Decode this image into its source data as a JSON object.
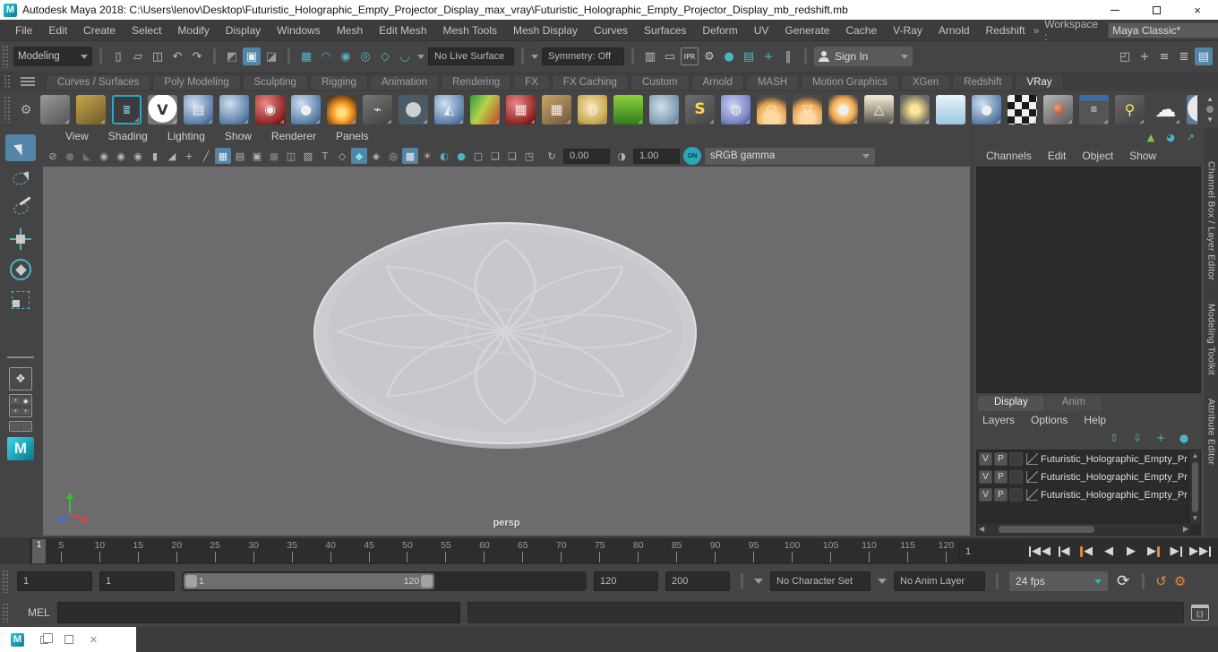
{
  "colors": {
    "accent": "#5285a6",
    "teal": "#4db5c4",
    "orange": "#dd8b3a",
    "maya_teal": "#12a5b5"
  },
  "titlebar": {
    "title": "Autodesk Maya 2018: C:\\Users\\lenov\\Desktop\\Futuristic_Holographic_Empty_Projector_Display_max_vray\\Futuristic_Holographic_Empty_Projector_Display_mb_redshift.mb"
  },
  "menubar": {
    "items": [
      "File",
      "Edit",
      "Create",
      "Select",
      "Modify",
      "Display",
      "Windows",
      "Mesh",
      "Edit Mesh",
      "Mesh Tools",
      "Mesh Display",
      "Curves",
      "Surfaces",
      "Deform",
      "UV",
      "Generate",
      "Cache",
      "V-Ray",
      "Arnold",
      "Redshift"
    ],
    "chevrons": "»",
    "workspace_label": "Workspace :",
    "workspace_value": "Maya Classic*"
  },
  "statusline": {
    "mode_selector": "Modeling",
    "file_icons": [
      {
        "name": "new-scene-icon",
        "label": "▯"
      },
      {
        "name": "open-scene-icon",
        "label": "▱"
      },
      {
        "name": "save-scene-icon",
        "label": "◫"
      },
      {
        "name": "undo-icon",
        "label": "↶"
      },
      {
        "name": "redo-icon",
        "label": "↷"
      }
    ],
    "select_icons": [
      {
        "name": "select-hierarchy-icon",
        "label": "◩",
        "c": "dim2"
      },
      {
        "name": "select-object-icon",
        "label": "▣",
        "active": true
      },
      {
        "name": "select-component-icon",
        "label": "◪",
        "c": "dim2"
      }
    ],
    "snap_icons": [
      {
        "name": "snap-grid-icon",
        "label": "▦",
        "c": "teal"
      },
      {
        "name": "snap-curve-icon",
        "label": "◠",
        "c": "teal"
      },
      {
        "name": "snap-point-icon",
        "label": "◉",
        "c": "teal"
      },
      {
        "name": "snap-projected-center-icon",
        "label": "◎",
        "c": "teal"
      },
      {
        "name": "snap-view-plane-icon",
        "label": "◇",
        "c": "teal"
      },
      {
        "name": "make-live-icon",
        "label": "◡",
        "c": "teal"
      }
    ],
    "live_surface": "No Live Surface",
    "symmetry": "Symmetry: Off",
    "render_icons": [
      {
        "name": "render-view-icon",
        "label": "▥"
      },
      {
        "name": "render-current-frame-icon",
        "label": "▭"
      },
      {
        "name": "ipr-render-icon",
        "label": "IPR",
        "c": "ipr"
      },
      {
        "name": "render-settings-icon",
        "label": "⚙"
      },
      {
        "name": "render-sphere-icon",
        "label": "●",
        "c": "teal"
      },
      {
        "name": "render-layers-icon",
        "label": "▤",
        "c": "teal"
      },
      {
        "name": "hypershade-icon",
        "label": "+",
        "c": "teal"
      },
      {
        "name": "pause-viewport-icon",
        "label": "‖"
      }
    ],
    "sign_in": "Sign In",
    "sidebar_toggles": [
      {
        "name": "show-modeling-toolkit-icon",
        "label": "◰"
      },
      {
        "name": "show-humanik-icon",
        "label": "+"
      },
      {
        "name": "show-channel-box-icon",
        "label": "≡"
      },
      {
        "name": "show-attribute-editor-icon",
        "label": "≣"
      },
      {
        "name": "show-tool-settings-icon",
        "label": "▤",
        "active": true
      }
    ]
  },
  "shelf": {
    "tabs": [
      {
        "label": "Curves / Surfaces"
      },
      {
        "label": "Poly Modeling"
      },
      {
        "label": "Sculpting"
      },
      {
        "label": "Rigging"
      },
      {
        "label": "Animation"
      },
      {
        "label": "Rendering"
      },
      {
        "label": "FX"
      },
      {
        "label": "FX Caching"
      },
      {
        "label": "Custom"
      },
      {
        "label": "Arnold"
      },
      {
        "label": "MASH"
      },
      {
        "label": "Motion Graphics"
      },
      {
        "label": "XGen"
      },
      {
        "label": "Redshift"
      },
      {
        "label": "VRay",
        "active": true
      }
    ],
    "icons": [
      {
        "name": "vray-mesh-export-icon",
        "c": "s-gray"
      },
      {
        "name": "vray-mesh-import-icon",
        "c": "s-folder"
      },
      {
        "name": "vray-import-options-icon",
        "c": "s-teal-outline",
        "label": "≣"
      },
      {
        "name": "vray-logo-icon",
        "c": "s-vray",
        "label": "V"
      },
      {
        "name": "vray-material-library-icon",
        "c": "s-blue",
        "label": "▤"
      },
      {
        "name": "vray-light-meter-icon",
        "c": "s-blue"
      },
      {
        "name": "vray-physical-camera-icon",
        "c": "s-red",
        "label": "◉"
      },
      {
        "name": "vray-material-spheres-icon",
        "c": "s-blue",
        "label": "●"
      },
      {
        "name": "vray-volume-grid-fire-icon",
        "c": "s-fire"
      },
      {
        "name": "vray-infinite-plane-icon",
        "c": "s-plane",
        "label": "⌁"
      },
      {
        "name": "vray-softbox-icon",
        "c": "s-softbox"
      },
      {
        "name": "vray-clipper-icon",
        "c": "s-blue",
        "label": "◭"
      },
      {
        "name": "vray-lightmap-icon",
        "c": "s-heat"
      },
      {
        "name": "vray-proxy-icon",
        "c": "s-red",
        "label": "▦"
      },
      {
        "name": "vray-scene-icon",
        "c": "s-tan",
        "label": "▦"
      },
      {
        "name": "vray-sphere-fade-icon",
        "c": "s-globe",
        "label": "◍"
      },
      {
        "name": "vray-fur-icon",
        "c": "s-grass"
      },
      {
        "name": "vray-displacement-icon",
        "c": "s-rock"
      },
      {
        "name": "vray-spline-icon",
        "c": "s-spline",
        "label": "S"
      },
      {
        "name": "vray-geosphere-icon",
        "c": "s-purp",
        "label": "◍"
      },
      {
        "name": "vray-dome-light-icon",
        "c": "s-dome",
        "label": "◠"
      },
      {
        "name": "vray-rect-light-icon",
        "c": "s-dome",
        "label": "▽"
      },
      {
        "name": "vray-sphere-light-icon",
        "c": "s-orange",
        "label": "●"
      },
      {
        "name": "vray-ies-light-icon",
        "c": "s-cone",
        "label": "△"
      },
      {
        "name": "vray-sun-light-icon",
        "c": "s-sun",
        "label": "☀"
      },
      {
        "name": "vray-sky-icon",
        "c": "s-sky"
      },
      {
        "name": "vray-ocean-icon",
        "c": "s-blue",
        "label": "●"
      },
      {
        "name": "vray-checker-icon",
        "c": "s-checker"
      },
      {
        "name": "render-view-shelf-icon",
        "c": "s-rview"
      },
      {
        "name": "render-settings-shelf-icon",
        "c": "s-panel",
        "label": "≡"
      },
      {
        "name": "light-bulb-icon",
        "c": "s-bulb",
        "label": "⚲"
      },
      {
        "name": "cloud-icon",
        "c": "s-cloud",
        "label": "☁"
      },
      {
        "name": "help-icon",
        "c": "s-help",
        "label": "?"
      }
    ]
  },
  "toolbox": {
    "tools": [
      {
        "name": "select-tool-icon",
        "c": "t-select",
        "active": true
      },
      {
        "name": "lasso-tool-icon",
        "c": "t-lasso"
      },
      {
        "name": "paint-select-tool-icon",
        "c": "t-paint"
      },
      {
        "name": "move-tool-icon",
        "c": "t-move"
      },
      {
        "name": "rotate-tool-icon",
        "c": "t-rotate"
      },
      {
        "name": "scale-tool-icon",
        "c": "t-scale"
      }
    ]
  },
  "viewport": {
    "menus": [
      "View",
      "Shading",
      "Lighting",
      "Show",
      "Renderer",
      "Panels"
    ],
    "toolbar_icons": [
      {
        "name": "vray-vfb-icon",
        "label": "⊘"
      },
      {
        "name": "snap-together-icon",
        "label": "●",
        "c": "dim"
      },
      {
        "name": "selection-dim-icon",
        "label": "◣",
        "c": "dim"
      },
      {
        "name": "camera-select-icon",
        "label": "◉",
        "c": "dim2"
      },
      {
        "name": "camera-lock-icon",
        "label": "◉",
        "c": "dim2"
      },
      {
        "name": "camera-attributes-icon",
        "label": "◉",
        "c": "dim2"
      },
      {
        "name": "bookmark-icon",
        "label": "▮",
        "c": "dim2"
      },
      {
        "name": "image-plane-icon",
        "label": "◢",
        "c": "dim2"
      },
      {
        "name": "pan-zoom-icon",
        "label": "+",
        "c": "dim2"
      },
      {
        "name": "grease-pencil-icon",
        "label": "╱",
        "c": "dim2"
      },
      {
        "name": "grid-icon",
        "label": "▦",
        "active": true
      },
      {
        "name": "film-gate-icon",
        "label": "▤"
      },
      {
        "name": "resolution-gate-icon",
        "label": "▣"
      },
      {
        "name": "gate-mask-icon",
        "label": "■",
        "c": "dim"
      },
      {
        "name": "field-chart-icon",
        "label": "◫"
      },
      {
        "name": "safe-action-icon",
        "label": "▨"
      },
      {
        "name": "hud-text-icon",
        "label": "T"
      },
      {
        "name": "wireframe-icon",
        "label": "◇"
      },
      {
        "name": "smooth-shade-icon",
        "label": "◆",
        "active": true,
        "c": "teal"
      },
      {
        "name": "textured-icon",
        "label": "◈"
      },
      {
        "name": "lights-cube-icon",
        "label": "◎"
      },
      {
        "name": "wireframe-on-shaded-icon",
        "label": "▩",
        "active": true
      },
      {
        "name": "use-all-lights-icon",
        "label": "☀",
        "c": "dim2"
      },
      {
        "name": "shadows-icon",
        "label": "◐",
        "c": "teal"
      },
      {
        "name": "occlusion-icon",
        "label": "●",
        "c": "teal"
      },
      {
        "name": "isolate-select-icon",
        "label": "▢",
        "c": "dim2"
      },
      {
        "name": "stack-a-icon",
        "label": "❏",
        "c": "dim2"
      },
      {
        "name": "stack-b-icon",
        "label": "❏",
        "c": "dim2"
      },
      {
        "name": "crop-icon",
        "label": "◳",
        "c": "dim2"
      }
    ],
    "exposure_value": "0.00",
    "contrast_value": "1.00",
    "on_label": "ON",
    "gamma_value": "sRGB gamma",
    "camera_label": "persp"
  },
  "channel_box": {
    "top_icons": [
      {
        "name": "show-manipulators-icon",
        "label": "▲",
        "c": "cb-star"
      },
      {
        "name": "speed-control-icon",
        "label": "◕",
        "c": "teal"
      },
      {
        "name": "graph-icon",
        "label": "↗",
        "c": "teal"
      }
    ],
    "menus": [
      "Channels",
      "Edit",
      "Object",
      "Show"
    ]
  },
  "layer_editor": {
    "tabs": [
      {
        "label": "Display",
        "active": true
      },
      {
        "label": "Anim"
      }
    ],
    "menus": [
      "Layers",
      "Options",
      "Help"
    ],
    "buttons": [
      {
        "name": "move-layer-up-icon",
        "label": "⇧"
      },
      {
        "name": "move-layer-down-icon",
        "label": "⇩"
      },
      {
        "name": "create-empty-layer-icon",
        "label": "+"
      },
      {
        "name": "create-layer-from-selected-icon",
        "label": "●"
      }
    ],
    "layers": [
      {
        "v": "V",
        "p": "P",
        "label": "Futuristic_Holographic_Empty_Pr"
      },
      {
        "v": "V",
        "p": "P",
        "label": "Futuristic_Holographic_Empty_Pr"
      },
      {
        "v": "V",
        "p": "P",
        "label": "Futuristic_Holographic_Empty_Pr"
      }
    ]
  },
  "sidetabs": [
    "Channel Box / Layer Editor",
    "Modeling Toolkit",
    "Attribute Editor"
  ],
  "timeline": {
    "ticks": [
      5,
      10,
      15,
      20,
      25,
      30,
      35,
      40,
      45,
      50,
      55,
      60,
      65,
      70,
      75,
      80,
      85,
      90,
      95,
      100,
      105,
      110,
      115,
      120
    ],
    "current_frame": "1",
    "frame_field": "1",
    "playback": [
      "go-to-start",
      "step-back-frame",
      "step-back-key",
      "play-backwards",
      "play-forward",
      "step-forward-key",
      "step-forward-frame",
      "go-to-end"
    ]
  },
  "range_slider": {
    "animation_start": "1",
    "playback_start": "1",
    "range_start_label": "1",
    "range_end_label": "120",
    "playback_end": "120",
    "animation_end": "200",
    "character_set": "No Character Set",
    "anim_layer": "No Anim Layer",
    "fps": "24 fps"
  },
  "command_line": {
    "label": "MEL"
  }
}
